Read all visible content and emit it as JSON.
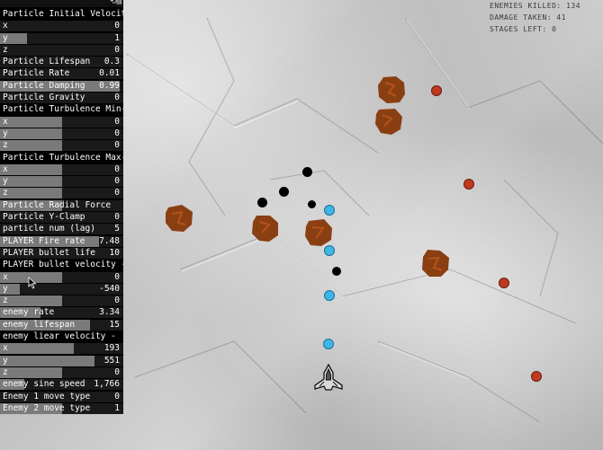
{
  "hud": {
    "enemies_killed": "ENEMIES KILLED: 134",
    "damage_taken": "DAMAGE TAKEN: 41",
    "stages_left": "STAGES LEFT: 0"
  },
  "panel": {
    "top_icons": "⟲▤",
    "rows": [
      {
        "label": "Particle Initial Velocity",
        "value": "",
        "header": true,
        "fill": 0
      },
      {
        "label": "x",
        "value": "0",
        "fill": 0
      },
      {
        "label": "y",
        "value": "1",
        "fill": 0.22
      },
      {
        "label": "z",
        "value": "0",
        "fill": 0
      },
      {
        "label": "Particle Lifespan",
        "value": "0.3",
        "fill": 0
      },
      {
        "label": "Particle Rate",
        "value": "0.01",
        "fill": 0
      },
      {
        "label": "Particle Damping",
        "value": "0.99",
        "fill": 0.97
      },
      {
        "label": "Particle Gravity",
        "value": "0",
        "fill": 0
      },
      {
        "label": "Particle Turbulence Min-",
        "value": "",
        "header": true,
        "fill": 0
      },
      {
        "label": "x",
        "value": "0",
        "fill": 0.5
      },
      {
        "label": "y",
        "value": "0",
        "fill": 0.5
      },
      {
        "label": "z",
        "value": "0",
        "fill": 0.5
      },
      {
        "label": "Particle Turbulence Max-",
        "value": "",
        "header": true,
        "fill": 0
      },
      {
        "label": "x",
        "value": "0",
        "fill": 0.5
      },
      {
        "label": "y",
        "value": "0",
        "fill": 0.5
      },
      {
        "label": "z",
        "value": "0",
        "fill": 0.5
      },
      {
        "label": "Particle Radial Force",
        "value": "",
        "fill": 0.5
      },
      {
        "label": "Particle Y-Clamp",
        "value": "0",
        "fill": 0
      },
      {
        "label": "particle num (lag)",
        "value": "5",
        "fill": 0
      },
      {
        "label": "PLAYER Fire rate",
        "value": "7.48",
        "fill": 0.8
      },
      {
        "label": "PLAYER bullet life",
        "value": "10",
        "fill": 0
      },
      {
        "label": "PLAYER bullet velocity -",
        "value": "",
        "header": true,
        "fill": 0
      },
      {
        "label": "x",
        "value": "0",
        "fill": 0.5
      },
      {
        "label": "y",
        "value": "-540",
        "fill": 0.16
      },
      {
        "label": "z",
        "value": "0",
        "fill": 0.5
      },
      {
        "label": "enemy rate",
        "value": "3.34",
        "fill": 0.33
      },
      {
        "label": "enemy lifespan",
        "value": "15",
        "fill": 0.73
      },
      {
        "label": "enemy liear velocity -",
        "value": "",
        "header": true,
        "fill": 0
      },
      {
        "label": "x",
        "value": "193",
        "fill": 0.6
      },
      {
        "label": "y",
        "value": "551",
        "fill": 0.77
      },
      {
        "label": "z",
        "value": "0",
        "fill": 0.5
      },
      {
        "label": "enemy sine speed",
        "value": "1,766",
        "fill": 0.2
      },
      {
        "label": "Enemy 1 move type",
        "value": "0",
        "fill": 0
      },
      {
        "label": "Enemy 2 move type",
        "value": "1",
        "fill": 0.5
      }
    ]
  },
  "colors": {
    "enemy_blob": "#8a3f12",
    "red_enemy": "#c0391e",
    "bullet": "#3fb6e6",
    "panel_bg": "#000000",
    "slider_fill": "#7a7a7a"
  },
  "icons": {
    "ship": "spaceship-icon",
    "cursor": "mouse-cursor-icon"
  }
}
